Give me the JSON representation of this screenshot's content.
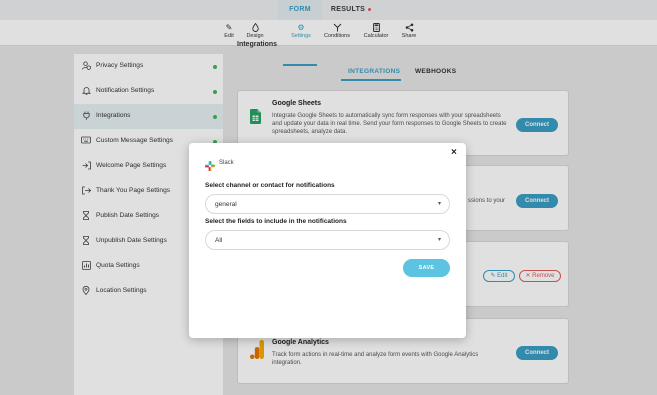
{
  "top_tabs": {
    "form": "FORM",
    "results": "RESULTS"
  },
  "toolbar": {
    "edit": "Edit",
    "design": "Design",
    "settings": "Settings",
    "conditions": "Conditions",
    "calculator": "Calculator",
    "share": "Share"
  },
  "sidebar": {
    "items": [
      {
        "label": "Privacy Settings",
        "icon": "user-shield-icon",
        "dot": true
      },
      {
        "label": "Notification Settings",
        "icon": "bell-icon",
        "dot": true
      },
      {
        "label": "Integrations",
        "icon": "plug-icon",
        "dot": true,
        "active": true
      },
      {
        "label": "Custom Message Settings",
        "icon": "keyboard-icon",
        "dot": true
      },
      {
        "label": "Welcome Page Settings",
        "icon": "sign-in-icon",
        "dot": false
      },
      {
        "label": "Thank You Page Settings",
        "icon": "sign-out-icon",
        "dot": false
      },
      {
        "label": "Publish Date Settings",
        "icon": "hourglass-icon",
        "dot": false
      },
      {
        "label": "Unpublish Date Settings",
        "icon": "hourglass-icon",
        "dot": false
      },
      {
        "label": "Quota Settings",
        "icon": "quota-icon",
        "dot": false
      },
      {
        "label": "Location Settings",
        "icon": "location-pin-icon",
        "dot": false
      }
    ]
  },
  "main": {
    "heading": "Integrations",
    "tabs": {
      "integrations": "INTEGRATIONS",
      "webhooks": "WEBHOOKS"
    },
    "cards": {
      "google_sheets": {
        "title": "Google Sheets",
        "description": "Integrate Google Sheets to automatically sync form responses with your spreadsheets and update your data in real time. Send your form responses to Google Sheets to create spreadsheets, analyze data.",
        "button": "Connect"
      },
      "second": {
        "description_tail": "ssions to your",
        "button": "Connect"
      },
      "third": {
        "edit": "Edit",
        "remove": "Remove"
      },
      "google_analytics": {
        "title": "Google Analytics",
        "description": "Track form actions in real-time and analyze form events with Google Analytics integration.",
        "button": "Connect"
      }
    }
  },
  "modal": {
    "title": "Slack",
    "close": "×",
    "channel_label": "Select channel or contact for notifications",
    "channel_value": "general",
    "fields_label": "Select the fields to include in the notifications",
    "fields_value": "All",
    "save": "SAVE"
  },
  "colors": {
    "accent": "#3a9fc4",
    "save_button": "#5cc3e1",
    "status_dot": "#3cb85a",
    "remove": "#e05c5c"
  }
}
